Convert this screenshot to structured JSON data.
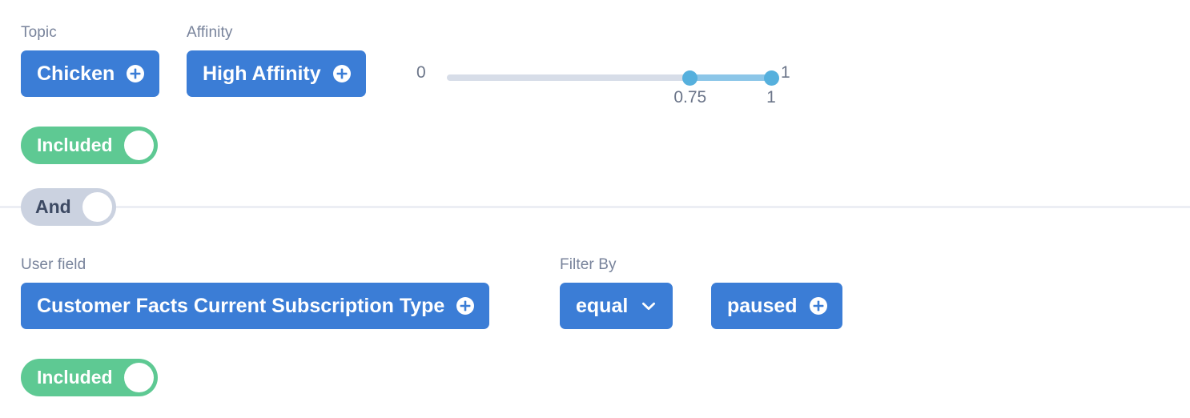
{
  "groups": [
    {
      "name": "topic-affinity-group",
      "fields": [
        {
          "label": "Topic",
          "value": "Chicken",
          "icon": "plus-circle-icon"
        },
        {
          "label": "Affinity",
          "value": "High Affinity",
          "icon": "plus-circle-icon"
        }
      ],
      "slider": {
        "min_label": "0",
        "max_label": "1",
        "min": 0,
        "max": 1,
        "lower_value": 0.75,
        "upper_value": 1,
        "lower_value_label": "0.75",
        "upper_value_label": "1",
        "rail_color": "#d7dde8",
        "fill_color": "#8cc6e8",
        "handle_color": "#56b0dd"
      },
      "toggle": {
        "label": "Included",
        "state": "on",
        "color": "#5ec993"
      }
    },
    {
      "name": "user-field-group",
      "fields": [
        {
          "label": "User field",
          "value": "Customer Facts Current Subscription Type",
          "icon": "plus-circle-icon"
        },
        {
          "label": "Filter By",
          "value": "equal",
          "icon": "chevron-down-icon"
        },
        {
          "label": "",
          "value": "paused",
          "icon": "plus-circle-icon"
        }
      ],
      "toggle": {
        "label": "Included",
        "state": "on",
        "color": "#5ec993"
      }
    }
  ],
  "conjunction": {
    "label": "And",
    "state": "off",
    "color": "#cbd2e0"
  },
  "theme": {
    "chip_color": "#3b7dd6",
    "label_color": "#78839b",
    "divider_color": "#eceef4",
    "background": "#ffffff"
  }
}
